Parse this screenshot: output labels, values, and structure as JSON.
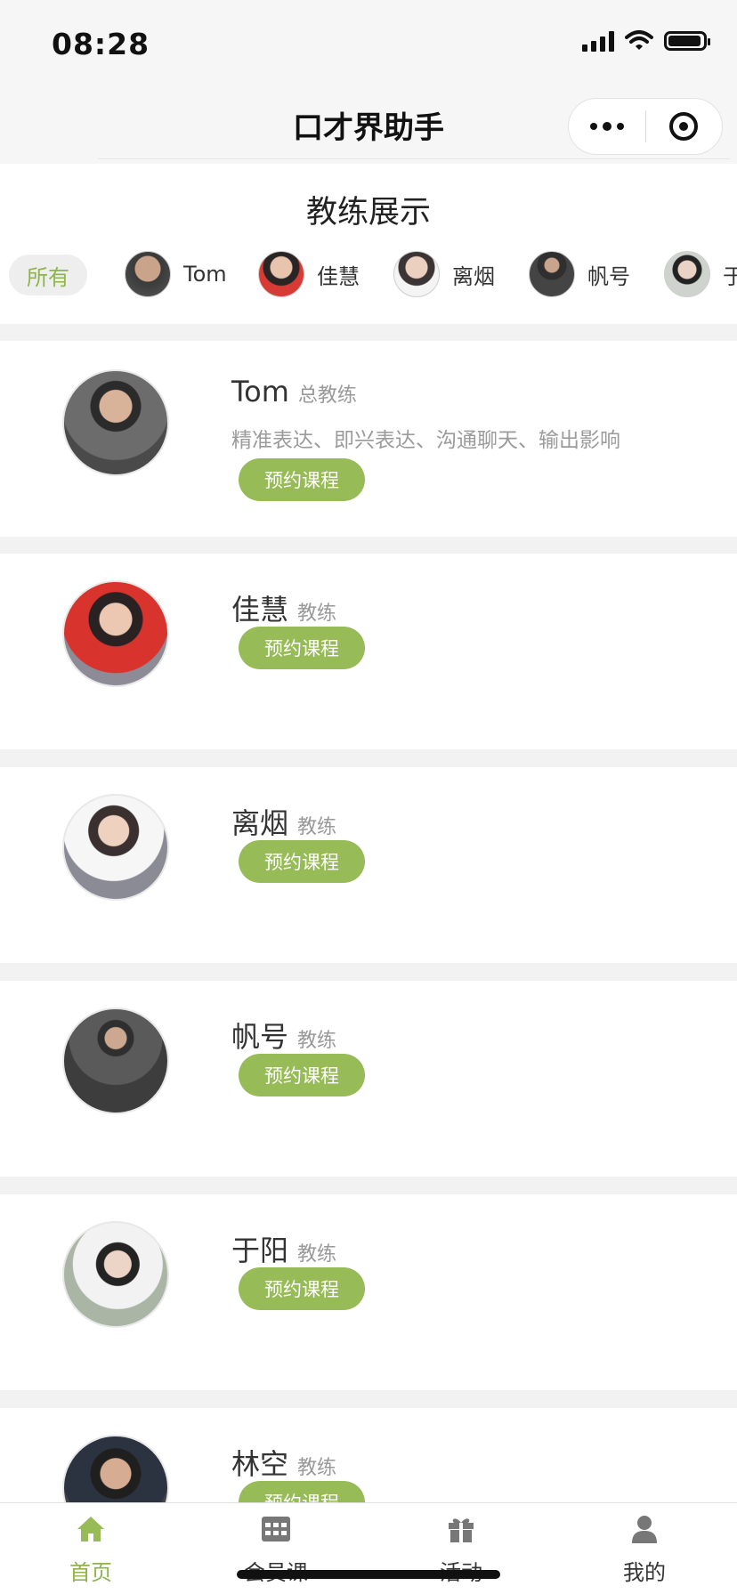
{
  "status_bar": {
    "time": "08:28"
  },
  "nav": {
    "title": "口才界助手"
  },
  "section": {
    "title": "教练展示"
  },
  "filter": {
    "all_label": "所有",
    "chips": [
      {
        "name": "Tom"
      },
      {
        "name": "佳慧"
      },
      {
        "name": "离烟"
      },
      {
        "name": "帆号"
      },
      {
        "name": "于"
      }
    ]
  },
  "coaches": [
    {
      "name": "Tom",
      "role": "总教练",
      "desc": "精准表达、即兴表达、沟通聊天、输出影响",
      "button": "预约课程"
    },
    {
      "name": "佳慧",
      "role": "教练",
      "desc": "",
      "button": "预约课程"
    },
    {
      "name": "离烟",
      "role": "教练",
      "desc": "",
      "button": "预约课程"
    },
    {
      "name": "帆号",
      "role": "教练",
      "desc": "",
      "button": "预约课程"
    },
    {
      "name": "于阳",
      "role": "教练",
      "desc": "",
      "button": "预约课程"
    },
    {
      "name": "林空",
      "role": "教练",
      "desc": "",
      "button": "预约课程"
    }
  ],
  "tabs": [
    {
      "label": "首页",
      "icon": "home-icon",
      "active": true
    },
    {
      "label": "会员课",
      "icon": "calendar-grid-icon",
      "active": false
    },
    {
      "label": "活动",
      "icon": "gift-icon",
      "active": false
    },
    {
      "label": "我的",
      "icon": "user-icon",
      "active": false
    }
  ],
  "colors": {
    "accent": "#97bb56",
    "accent_text": "#8fb44d"
  }
}
